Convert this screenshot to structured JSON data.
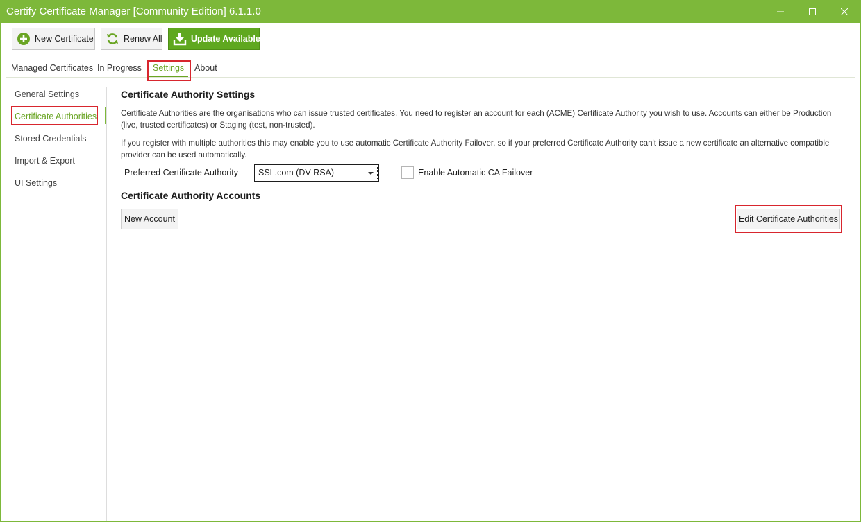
{
  "window": {
    "title": "Certify Certificate Manager [Community Edition] 6.1.1.0",
    "accent_color": "#7db83a"
  },
  "toolbar": {
    "new_certificate": {
      "label": "New Certificate",
      "icon": "plus-circle-icon"
    },
    "renew_all": {
      "label": "Renew All",
      "icon": "refresh-icon"
    },
    "update_available": {
      "label": "Update Available",
      "icon": "download-icon",
      "color": "#5fa81f"
    }
  },
  "tabs": [
    {
      "label": "Managed Certificates"
    },
    {
      "label": "In Progress"
    },
    {
      "label": "Settings",
      "selected": true
    },
    {
      "label": "About"
    }
  ],
  "sidebar": {
    "items": [
      {
        "label": "General Settings"
      },
      {
        "label": "Certificate Authorities",
        "selected": true
      },
      {
        "label": "Stored Credentials"
      },
      {
        "label": "Import & Export"
      },
      {
        "label": "UI Settings"
      }
    ]
  },
  "main": {
    "heading": "Certificate Authority Settings",
    "description_1": "Certificate Authorities are the organisations who can issue trusted certificates. You need to register an account for each (ACME) Certificate Authority you wish to use. Accounts can either be Production (live, trusted certificates) or Staging (test, non-trusted).",
    "description_2": "If you register with multiple authorities this may enable you to use automatic Certificate Authority Failover, so if your preferred Certificate Authority can't issue a new certificate an alternative compatible provider can be used automatically.",
    "preferred_label": "Preferred Certificate Authority",
    "preferred_value": "SSL.com (DV RSA)",
    "failover_label": "Enable Automatic CA Failover",
    "failover_checked": false,
    "accounts_heading": "Certificate Authority Accounts",
    "new_account_label": "New Account",
    "edit_authorities_label": "Edit Certificate Authorities"
  }
}
